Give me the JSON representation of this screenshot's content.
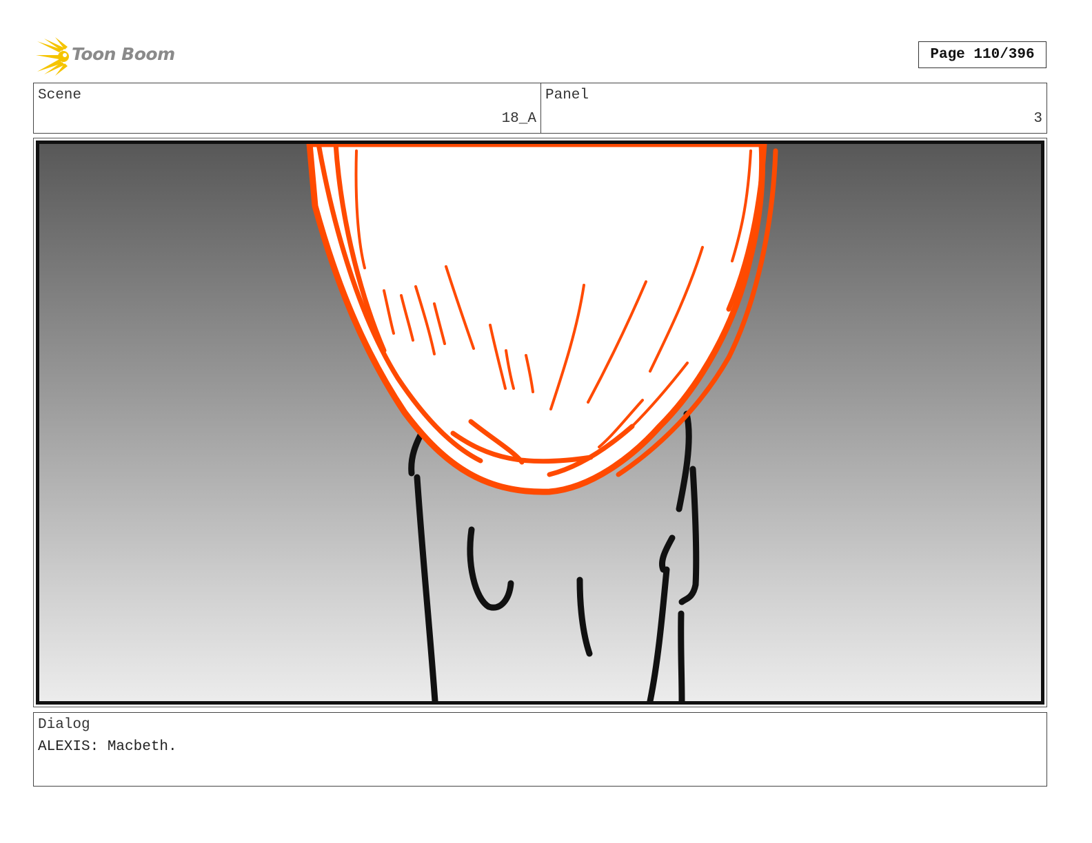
{
  "brand": {
    "name": "Toon Boom",
    "logo_icon": "starburst-icon",
    "accent": "#f5c400"
  },
  "header": {
    "page_label": "Page 110/396"
  },
  "info": {
    "scene_label": "Scene",
    "scene_value": "18_A",
    "panel_label": "Panel",
    "panel_value": "3"
  },
  "frame": {
    "description_icon": "storyboard-sketch",
    "colors": {
      "hair": "#ff4a00",
      "ink": "#111111"
    }
  },
  "dialog": {
    "label": "Dialog",
    "text": "ALEXIS: Macbeth."
  }
}
